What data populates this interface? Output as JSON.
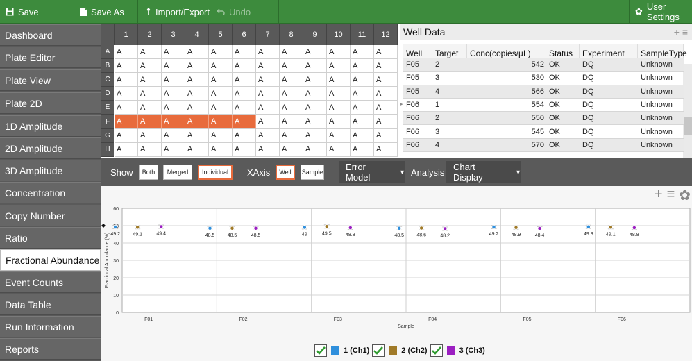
{
  "toolbar": {
    "save": "Save",
    "save_as": "Save As",
    "import_export": "Import/Export",
    "undo": "Undo",
    "user_settings": "User Settings"
  },
  "sidebar": {
    "items": [
      {
        "label": "Dashboard"
      },
      {
        "label": "Plate Editor"
      },
      {
        "label": "Plate View"
      },
      {
        "label": "Plate 2D"
      },
      {
        "label": "1D Amplitude"
      },
      {
        "label": "2D Amplitude"
      },
      {
        "label": "3D Amplitude"
      },
      {
        "label": "Concentration"
      },
      {
        "label": "Copy Number"
      },
      {
        "label": "Ratio"
      },
      {
        "label": "Fractional Abundance"
      },
      {
        "label": "Event Counts"
      },
      {
        "label": "Data Table"
      },
      {
        "label": "Run Information"
      },
      {
        "label": "Reports"
      }
    ],
    "active": "Fractional Abundance"
  },
  "plate": {
    "columns": [
      "1",
      "2",
      "3",
      "4",
      "5",
      "6",
      "7",
      "8",
      "9",
      "10",
      "11",
      "12"
    ],
    "rows": [
      "A",
      "B",
      "C",
      "D",
      "E",
      "F",
      "G",
      "H"
    ],
    "cell_value": "A",
    "selected_row": "F",
    "selected_columns": 6
  },
  "well_data": {
    "title": "Well Data",
    "headers": [
      "Well",
      "Target",
      "Conc(copies/µL)",
      "Status",
      "Experiment",
      "SampleType"
    ],
    "rows": [
      [
        "F05",
        "2",
        "542",
        "OK",
        "DQ",
        "Unknown"
      ],
      [
        "F05",
        "3",
        "530",
        "OK",
        "DQ",
        "Unknown"
      ],
      [
        "F05",
        "4",
        "566",
        "OK",
        "DQ",
        "Unknown"
      ],
      [
        "F06",
        "1",
        "554",
        "OK",
        "DQ",
        "Unknown"
      ],
      [
        "F06",
        "2",
        "550",
        "OK",
        "DQ",
        "Unknown"
      ],
      [
        "F06",
        "3",
        "545",
        "OK",
        "DQ",
        "Unknown"
      ],
      [
        "F06",
        "4",
        "570",
        "OK",
        "DQ",
        "Unknown"
      ]
    ]
  },
  "controls": {
    "show_label": "Show",
    "both": "Both",
    "merged": "Merged",
    "individual": "Individual",
    "xaxis_label": "XAxis",
    "well": "Well",
    "sample": "Sample",
    "error_model": "Error Model",
    "analysis": "Analysis",
    "chart_display": "Chart Display"
  },
  "chart_data": {
    "type": "scatter",
    "categories": [
      "F01",
      "F02",
      "F03",
      "F04",
      "F05",
      "F06"
    ],
    "series": [
      {
        "name": "1 (Ch1)",
        "color": "#2f8fdc",
        "values": [
          49.2,
          48.5,
          49,
          48.5,
          49.2,
          49.3
        ]
      },
      {
        "name": "2 (Ch2)",
        "color": "#a07a28",
        "values": [
          49.1,
          48.5,
          49.5,
          48.6,
          48.9,
          49.1
        ]
      },
      {
        "name": "3 (Ch3)",
        "color": "#9b1fc1",
        "values": [
          49.4,
          48.5,
          48.8,
          48.2,
          48.4,
          48.8
        ]
      }
    ],
    "xlabel": "Sample",
    "ylabel": "Fractional Abundance (%)",
    "ylim": [
      0,
      60
    ],
    "yticks": [
      0,
      10,
      20,
      30,
      40,
      50,
      60
    ],
    "grid": true,
    "legend": "bottom"
  }
}
